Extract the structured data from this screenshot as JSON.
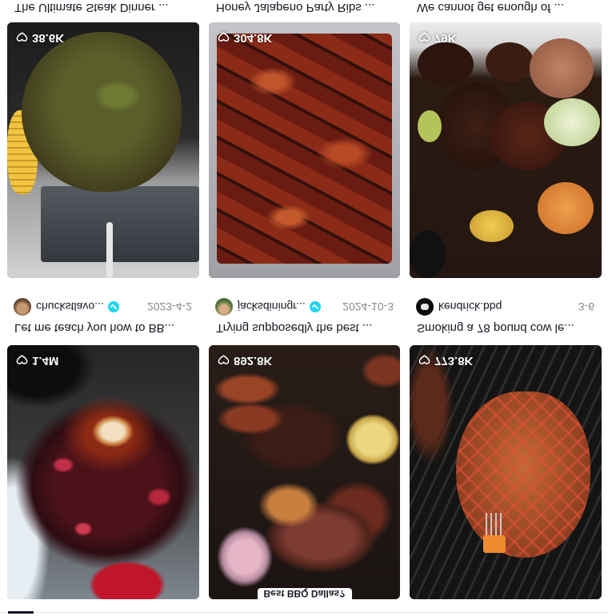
{
  "colors": {
    "verified": "#20d5ec",
    "text": "#161823",
    "muted": "#8a8b91"
  },
  "icons": {
    "views": "heart-outline-icon",
    "verified": "verified-check-icon"
  },
  "rows": [
    {
      "items": [
        {
          "views": "1.4M",
          "caption": "Let me teach you how to BB...",
          "user": "chuckstlavo...",
          "verified": true,
          "date": "2023-4-2"
        },
        {
          "views": "892.8K",
          "label": "Best BBQ Dallas?",
          "caption": "Trying supposedly the best ...",
          "user": "jacksdiningr...",
          "verified": true,
          "date": "2024-10-3"
        },
        {
          "views": "773.8K",
          "caption": "Smoking a 78 pound cow le...",
          "user": "kendrick.bbq",
          "verified": false,
          "date": "3-6"
        }
      ]
    },
    {
      "items": [
        {
          "views": "38.6K",
          "caption": "The Ultimate Steak Dinner ..."
        },
        {
          "views": "304.8K",
          "caption": "Honey Jalapeno Party Ribs ..."
        },
        {
          "views": "79K",
          "caption": "We cannot get enough of ..."
        }
      ]
    }
  ]
}
